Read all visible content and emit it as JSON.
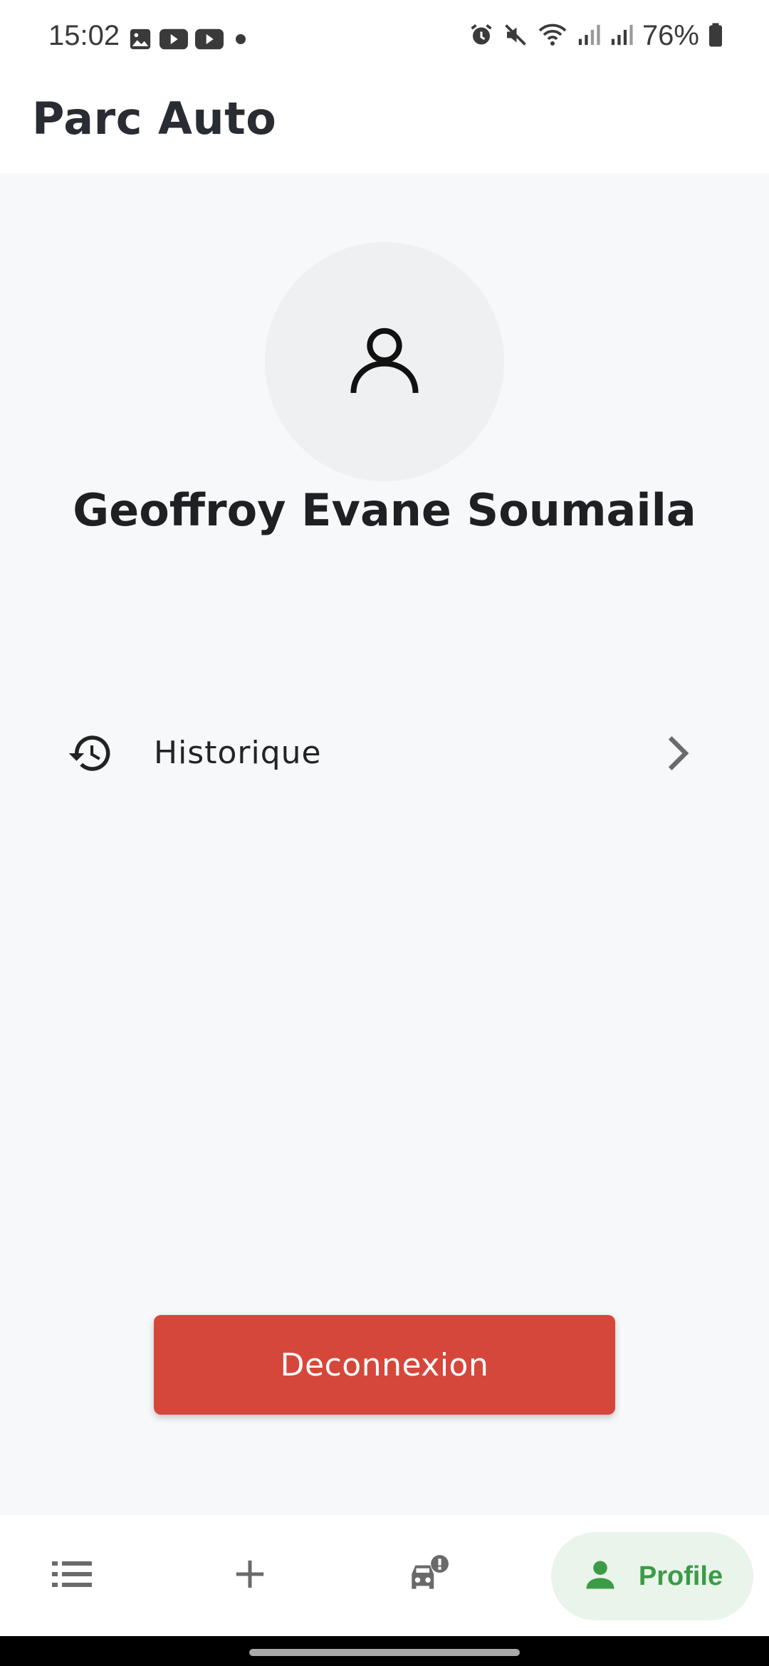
{
  "status_bar": {
    "time": "15:02",
    "battery": "76%",
    "left_icons": [
      "image-icon",
      "youtube-icon",
      "youtube-icon",
      "dot-icon"
    ],
    "right_icons": [
      "alarm-icon",
      "mute-icon",
      "wifi-icon",
      "signal-icon",
      "signal-icon",
      "battery-icon"
    ]
  },
  "app_bar": {
    "title": "Parc Auto"
  },
  "profile": {
    "avatar_icon": "person-outline-icon",
    "name": "Geoffroy Evane Soumaila"
  },
  "menu": {
    "items": [
      {
        "icon": "history-icon",
        "label": "Historique",
        "trailing_icon": "chevron-right-icon"
      }
    ]
  },
  "logout": {
    "label": "Deconnexion",
    "color": "#d6473b"
  },
  "bottom_nav": {
    "items": [
      {
        "icon": "list-icon",
        "active": false
      },
      {
        "icon": "plus-icon",
        "active": false
      },
      {
        "icon": "car-alert-icon",
        "active": false
      },
      {
        "icon": "person-icon",
        "label": "Profile",
        "active": true
      }
    ],
    "active_color": "#3b9b47",
    "active_background": "#e9f4ea"
  }
}
